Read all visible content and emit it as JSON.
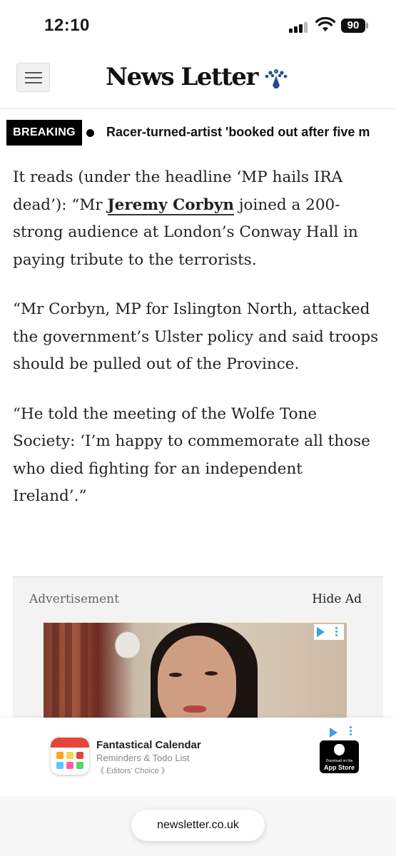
{
  "status_bar": {
    "time": "12:10",
    "battery": "90"
  },
  "header": {
    "logo": "News Letter"
  },
  "ticker": {
    "label": "BREAKING",
    "text": "Racer-turned-artist 'booked out after five m"
  },
  "article": {
    "p1_before": "It reads (under the headline ‘MP hails IRA dead’): “Mr ",
    "p1_link": "Jeremy Corbyn",
    "p1_after": " joined a 200-strong audience at London’s Conway Hall in paying tribute to the terrorists.",
    "p2": "“Mr Corbyn, MP for Islington North, attacked the government’s Ulster policy and said troops should be pulled out of the Province.",
    "p3": "“He told the meeting of the Wolfe Tone Society: ‘I’m happy to commemorate all those who died fighting for an independent Ireland’.”"
  },
  "advert": {
    "label": "Advertisement",
    "hide_label": "Hide Ad"
  },
  "app_banner": {
    "name": "Fantastical Calendar",
    "subtitle": "Reminders & Todo List",
    "badge": "《 Editors' Choice 》",
    "store_small": "Download on the",
    "store_big": "App Store"
  },
  "url_bar": {
    "url": "newsletter.co.uk"
  },
  "colors": {
    "breaking_bg": "#000000",
    "adchoices": "#3aa1e0",
    "calendar_red": "#e5463b"
  }
}
